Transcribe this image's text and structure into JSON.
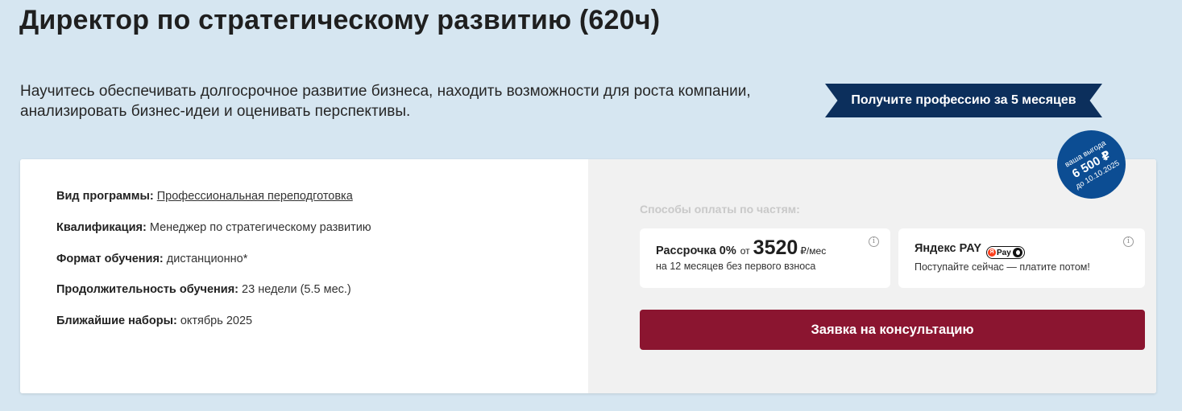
{
  "header": {
    "title": "Директор по стратегическому развитию (620ч)",
    "subtitle": "Научитесь обеспечивать долгосрочное развитие бизнеса, находить возможности для роста компании, анализировать бизнес-идеи и оценивать перспективы.",
    "ribbon": "Получите профессию за 5 месяцев"
  },
  "benefit_badge": {
    "line1": "ваша выгода",
    "amount": "6 500 ₽",
    "line3": "до 10.10.2025"
  },
  "program_info": [
    {
      "label": "Вид программы:",
      "value": "Профессиональная переподготовка"
    },
    {
      "label": "Квалификация:",
      "value": "Менеджер по стратегическому развитию"
    },
    {
      "label": "Формат обучения:",
      "value": "дистанционно*"
    },
    {
      "label": "Продолжительность обучения:",
      "value": "23 недели (5.5 мес.)"
    },
    {
      "label": "Ближайшие наборы:",
      "value": "октябрь 2025"
    }
  ],
  "payment": {
    "heading": "Способы оплаты по частям:",
    "installment": {
      "title": "Рассрочка 0%",
      "from": "от",
      "price": "3520",
      "unit": "₽/мес",
      "description": "на 12 месяцев без первого взноса"
    },
    "yandex_pay": {
      "title": "Яндекс PAY",
      "badge_text": "Pay",
      "description": "Поступайте сейчас — платите потом!"
    },
    "info_glyph": "i"
  },
  "cta": {
    "label": "Заявка на консультацию"
  },
  "colors": {
    "background": "#d6e6f1",
    "ribbon": "#0c2f5c",
    "badge": "#0c4d93",
    "cta": "#8b1530",
    "right_panel": "#f1f1f1"
  }
}
